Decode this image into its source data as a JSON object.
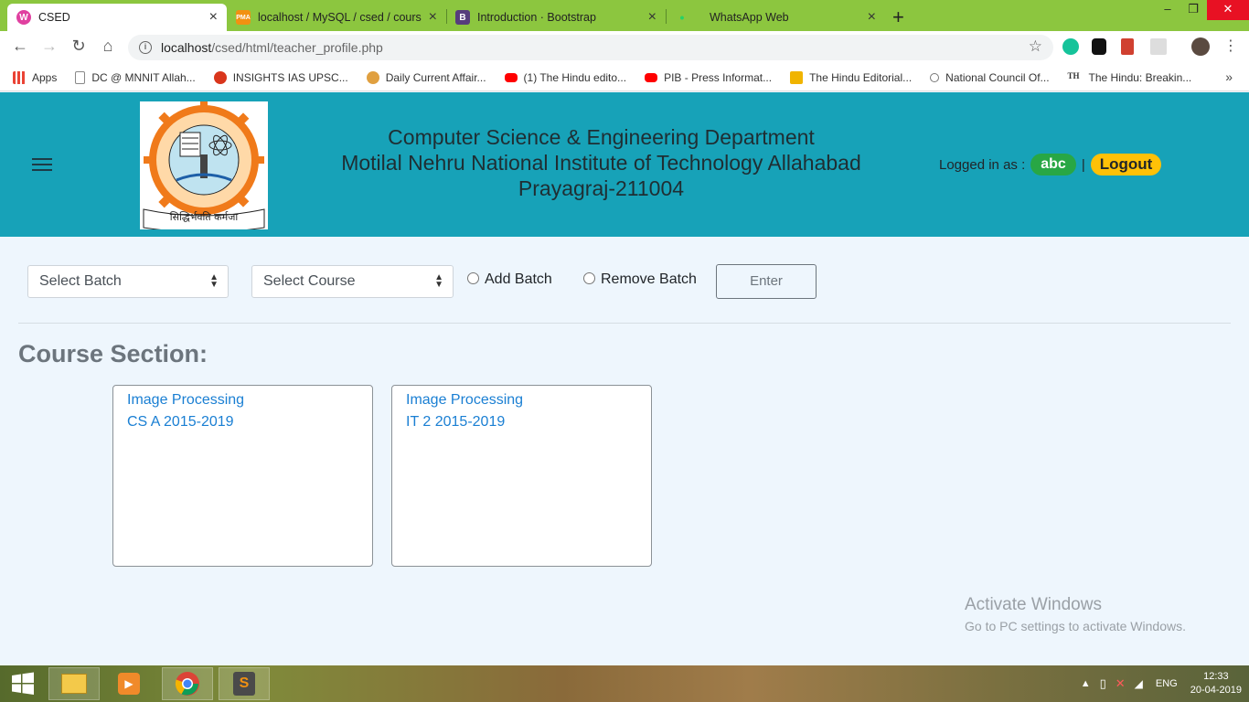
{
  "browser": {
    "tabs": [
      {
        "title": "CSED",
        "active": true,
        "icon": "w-logo-icon",
        "color": "#e040a0"
      },
      {
        "title": "localhost / MySQL / csed / cours",
        "active": false,
        "icon": "pma-icon",
        "color": "#f29111"
      },
      {
        "title": "Introduction · Bootstrap",
        "active": false,
        "icon": "bootstrap-icon",
        "color": "#563d7c"
      },
      {
        "title": "WhatsApp Web",
        "active": false,
        "icon": "whatsapp-icon",
        "color": "#25d366"
      }
    ],
    "url_host": "localhost",
    "url_path": "/csed/html/teacher_profile.php",
    "bookmarks": [
      {
        "label": "Apps",
        "icon": "apps-grid-icon",
        "color": "#4285f4"
      },
      {
        "label": "DC @ MNNIT Allah...",
        "icon": "page-icon",
        "color": "#888888"
      },
      {
        "label": "INSIGHTS IAS UPSC...",
        "icon": "insights-icon",
        "color": "#d9361c"
      },
      {
        "label": "Daily Current Affair...",
        "icon": "person-icon",
        "color": "#e0a040"
      },
      {
        "label": "(1) The Hindu edito...",
        "icon": "youtube-icon",
        "color": "#ff0000"
      },
      {
        "label": "PIB - Press Informat...",
        "icon": "youtube-icon",
        "color": "#ff0000"
      },
      {
        "label": "The Hindu Editorial...",
        "icon": "iq-icon",
        "color": "#f0b400"
      },
      {
        "label": "National Council Of...",
        "icon": "globe-icon",
        "color": "#777777"
      },
      {
        "label": "The Hindu: Breakin...",
        "icon": "th-icon",
        "color": "#333333"
      }
    ]
  },
  "header": {
    "line1": "Computer Science & Engineering Department",
    "line2": "Motilal Nehru National Institute of Technology Allahabad",
    "line3": "Prayagraj-211004",
    "logo_motto": "सिद्धिर्भवति कर्मजा",
    "logged_in_label": "Logged in as :",
    "username": "abc",
    "separator": "|",
    "logout_label": "Logout"
  },
  "controls": {
    "batch_select": "Select Batch",
    "course_select": "Select Course",
    "add_batch_label": "Add Batch",
    "remove_batch_label": "Remove Batch",
    "enter_label": "Enter"
  },
  "course_section": {
    "title": "Course Section:",
    "cards": [
      {
        "course": "Image Processing",
        "batch": "CS A 2015-2019"
      },
      {
        "course": "Image Processing",
        "batch": "IT 2 2015-2019"
      }
    ]
  },
  "watermark": {
    "line1": "Activate Windows",
    "line2": "Go to PC settings to activate Windows."
  },
  "taskbar": {
    "language": "ENG",
    "time": "12:33",
    "date": "20-04-2019"
  }
}
